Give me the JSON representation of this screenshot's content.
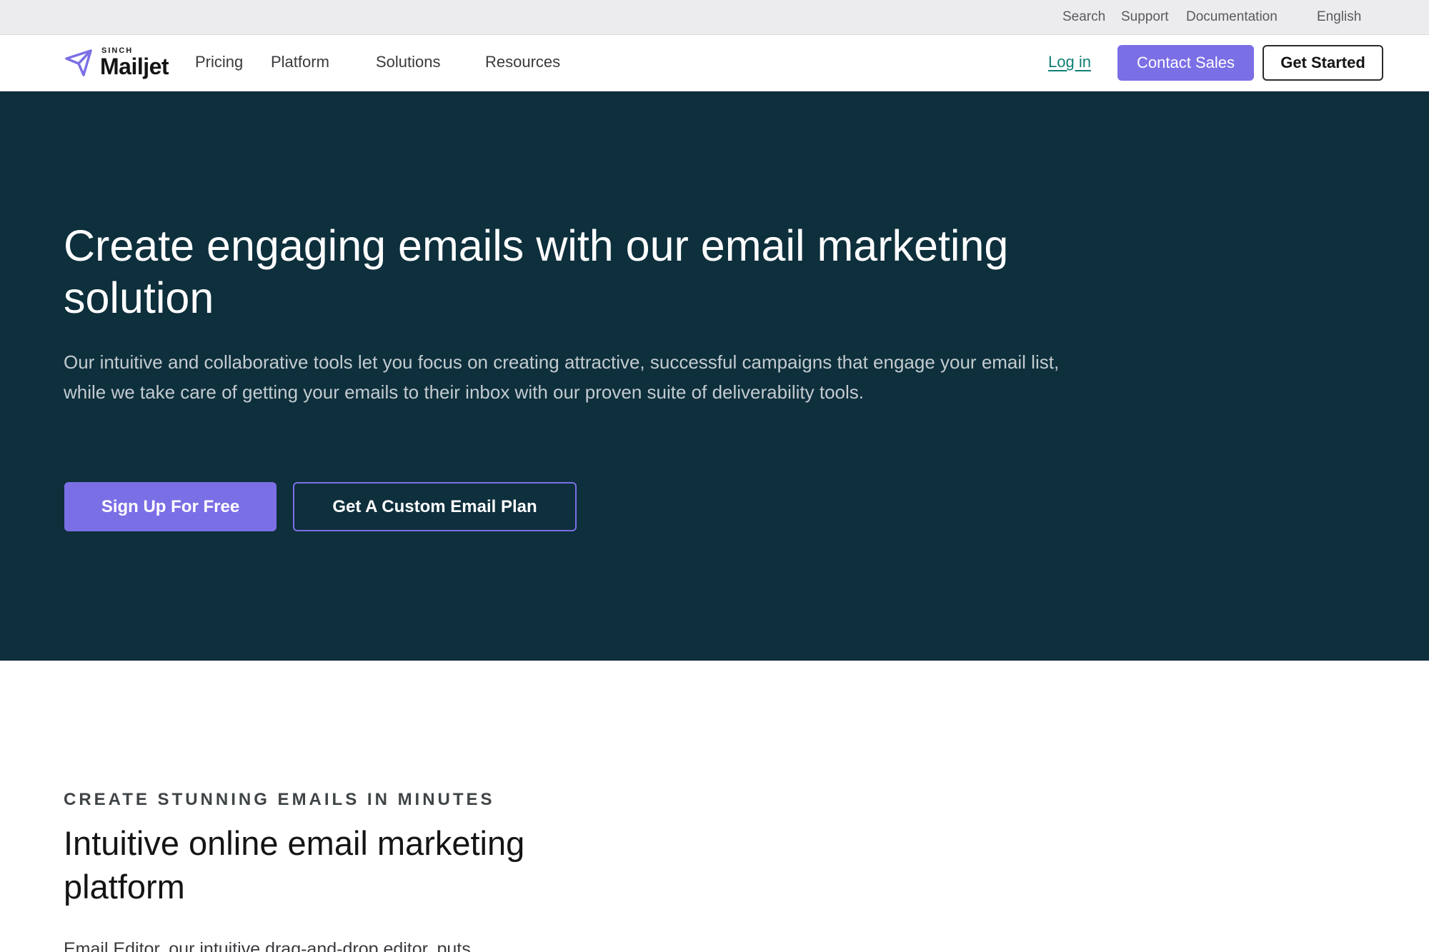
{
  "utility_bar": {
    "links": [
      "Search",
      "Support",
      "Documentation"
    ],
    "language": "English"
  },
  "nav": {
    "logo": {
      "brand_small": "SINCH",
      "brand": "Mailjet"
    },
    "items": [
      "Pricing",
      "Platform",
      "Solutions",
      "Resources"
    ],
    "login": "Log in",
    "contact_sales": "Contact Sales",
    "get_started": "Get Started"
  },
  "hero": {
    "title": "Create engaging emails with our email marketing solution",
    "description": "Our intuitive and collaborative tools let you focus on creating attractive, successful campaigns that engage your email list, while we take care of getting your emails to their inbox with our proven suite of deliverability tools.",
    "primary_cta": "Sign Up For Free",
    "secondary_cta": "Get A Custom Email Plan"
  },
  "section": {
    "eyebrow": "CREATE STUNNING EMAILS IN MINUTES",
    "title": "Intuitive online email marketing platform",
    "description": "Email Editor, our intuitive drag-and-drop editor, puts"
  },
  "colors": {
    "accent": "#7b6fe6",
    "hero_bg": "#0e2f3c",
    "link": "#0f7f74"
  }
}
